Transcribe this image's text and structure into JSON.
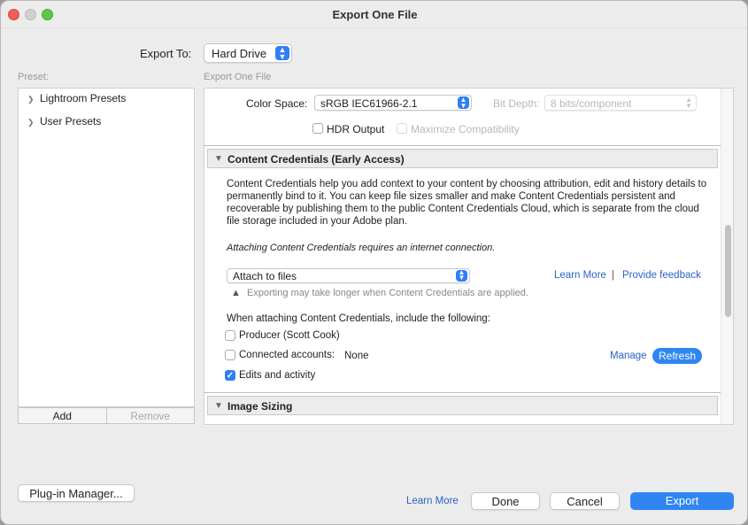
{
  "window": {
    "title": "Export One File"
  },
  "export_to": {
    "label": "Export To:",
    "value": "Hard Drive"
  },
  "presets": {
    "label": "Preset:",
    "items": [
      {
        "label": "Lightroom Presets"
      },
      {
        "label": "User Presets"
      }
    ],
    "add_label": "Add",
    "remove_label": "Remove"
  },
  "main": {
    "label": "Export One File",
    "file_settings": {
      "color_space_label": "Color Space:",
      "color_space_value": "sRGB IEC61966-2.1",
      "bit_depth_label": "Bit Depth:",
      "bit_depth_value": "8 bits/component",
      "hdr_label": "HDR Output",
      "hdr_checked": false,
      "max_compat_label": "Maximize Compatibility",
      "max_compat_checked": false
    },
    "content_credentials": {
      "title": "Content Credentials (Early Access)",
      "description": "Content Credentials help you add context to your content by choosing attribution, edit and history details to permanently bind to it. You can keep file sizes smaller and make Content Credentials persistent and recoverable by publishing them to the public Content Credentials Cloud, which is separate from the cloud file storage included in your Adobe plan.",
      "internet_note": "Attaching Content Credentials requires an internet connection.",
      "attach_value": "Attach to files",
      "learn_more": "Learn More",
      "divider": "|",
      "provide_feedback": "Provide feedback",
      "warning": "Exporting may take longer when Content Credentials are applied.",
      "include_label": "When attaching Content Credentials, include the following:",
      "producer_label": "Producer (Scott Cook)",
      "producer_checked": false,
      "connected_label": "Connected accounts:",
      "connected_value": "None",
      "connected_checked": false,
      "manage_label": "Manage",
      "refresh_label": "Refresh",
      "edits_label": "Edits and activity",
      "edits_checked": true
    },
    "image_sizing": {
      "title": "Image Sizing"
    }
  },
  "footer": {
    "plugin_manager": "Plug-in Manager...",
    "learn_more": "Learn More",
    "done": "Done",
    "cancel": "Cancel",
    "export": "Export"
  },
  "colors": {
    "accent": "#2f86f0",
    "link": "#2a63c7"
  }
}
